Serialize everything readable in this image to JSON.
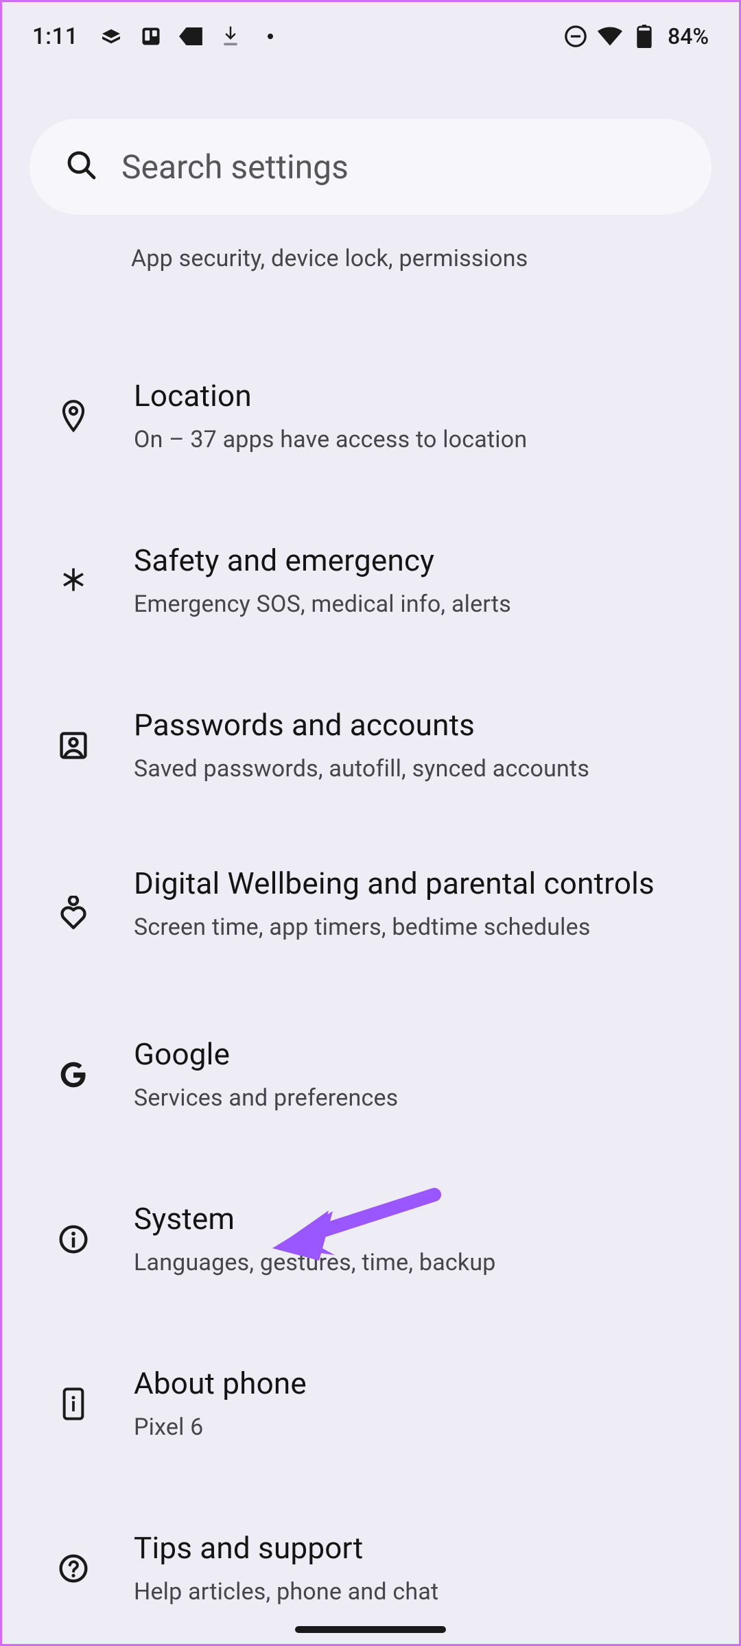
{
  "status_bar": {
    "time": "1:11",
    "battery_percent": "84%",
    "icons_left": [
      "box-icon",
      "trello-icon",
      "tag-icon",
      "download-icon",
      "dot-icon"
    ],
    "icons_right": [
      "do-not-disturb-icon",
      "wifi-icon",
      "battery-icon"
    ]
  },
  "search": {
    "placeholder": "Search settings"
  },
  "partial_item": {
    "subtitle": "App security, device lock, permissions"
  },
  "items": [
    {
      "icon": "location",
      "title": "Location",
      "subtitle": "On – 37 apps have access to location"
    },
    {
      "icon": "asterisk",
      "title": "Safety and emergency",
      "subtitle": "Emergency SOS, medical info, alerts"
    },
    {
      "icon": "account",
      "title": "Passwords and accounts",
      "subtitle": "Saved passwords, autofill, synced accounts"
    },
    {
      "icon": "wellbeing",
      "title": "Digital Wellbeing and parental controls",
      "subtitle": "Screen time, app timers, bedtime schedules"
    },
    {
      "icon": "google",
      "title": "Google",
      "subtitle": "Services and preferences"
    },
    {
      "icon": "info",
      "title": "System",
      "subtitle": "Languages, gestures, time, backup"
    },
    {
      "icon": "phone-info",
      "title": "About phone",
      "subtitle": "Pixel 6"
    },
    {
      "icon": "help",
      "title": "Tips and support",
      "subtitle": "Help articles, phone and chat"
    }
  ],
  "annotation": {
    "arrow_target": "System",
    "arrow_color": "#9a57ff"
  }
}
